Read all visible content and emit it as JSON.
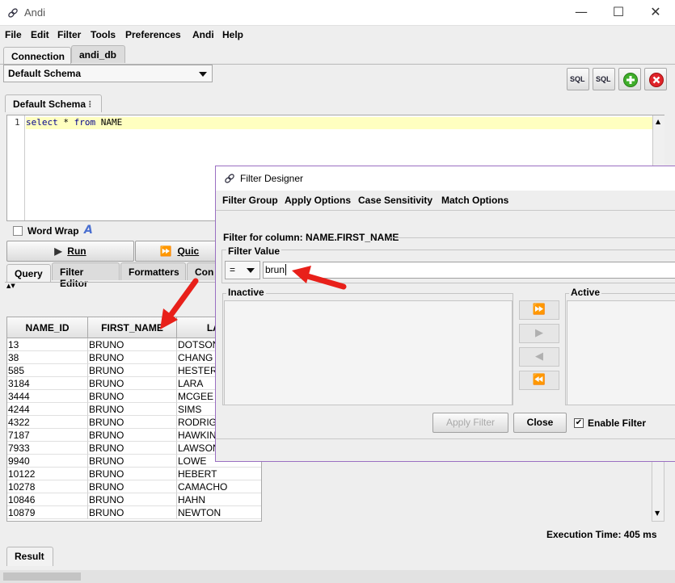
{
  "window": {
    "title": "Andi",
    "minimize": "—",
    "maximize": "☐",
    "close": "✕"
  },
  "menu": [
    "File",
    "Edit",
    "Filter",
    "Tools",
    "Preferences",
    "Andi",
    "Help"
  ],
  "conn_tabs": [
    "Connection",
    "andi_db"
  ],
  "schema_select": "Default Schema",
  "toolbar_icons": [
    "sql-run-icon",
    "sql-explain-icon",
    "add-icon",
    "remove-icon"
  ],
  "toolbar_labels": {
    "sql1": "SQL",
    "sql2": "SQL"
  },
  "editor_tab": "Default Schema",
  "editor": {
    "line_no": "1",
    "kw1": "select",
    "star": " * ",
    "kw2": "from",
    "rest": " NAME"
  },
  "word_wrap": "Word Wrap",
  "run_button": "Run",
  "quick_button": "Quic",
  "result_tabs": [
    "Query",
    "Filter Editor",
    "Formatters",
    "Con"
  ],
  "columns": [
    "NAME_ID",
    "FIRST_NAME",
    "LAST"
  ],
  "rows": [
    [
      "13",
      "BRUNO",
      "DOTSON"
    ],
    [
      "38",
      "BRUNO",
      "CHANG"
    ],
    [
      "585",
      "BRUNO",
      "HESTER"
    ],
    [
      "3184",
      "BRUNO",
      "LARA"
    ],
    [
      "3444",
      "BRUNO",
      "MCGEE"
    ],
    [
      "4244",
      "BRUNO",
      "SIMS"
    ],
    [
      "4322",
      "BRUNO",
      "RODRIG"
    ],
    [
      "7187",
      "BRUNO",
      "HAWKIN"
    ],
    [
      "7933",
      "BRUNO",
      "LAWSON"
    ],
    [
      "9940",
      "BRUNO",
      "LOWE"
    ],
    [
      "10122",
      "BRUNO",
      "HEBERT"
    ],
    [
      "10278",
      "BRUNO",
      "CAMACHO"
    ],
    [
      "10846",
      "BRUNO",
      "HAHN"
    ],
    [
      "10879",
      "BRUNO",
      "NEWTON"
    ]
  ],
  "execution_time": "Execution Time: 405 ms",
  "result_tab": "Result",
  "dialog": {
    "title": "Filter Designer",
    "menu": [
      "Filter Group",
      "Apply Options",
      "Case Sensitivity",
      "Match Options"
    ],
    "filter_for": "Filter for column: NAME.FIRST_NAME",
    "filter_value_label": "Filter Value",
    "operator": "=",
    "value": "brun",
    "inactive_label": "Inactive",
    "active_label": "Active",
    "move_buttons": [
      "⏩",
      "▶",
      "◀",
      "⏪"
    ],
    "apply_filter": "Apply Filter",
    "close": "Close",
    "enable_filter": "Enable Filter",
    "enable_checked": "✔"
  },
  "colors": {
    "accent_red": "#e8201a",
    "dialog_border": "#9a6fc2",
    "current_line": "#ffffc0"
  }
}
